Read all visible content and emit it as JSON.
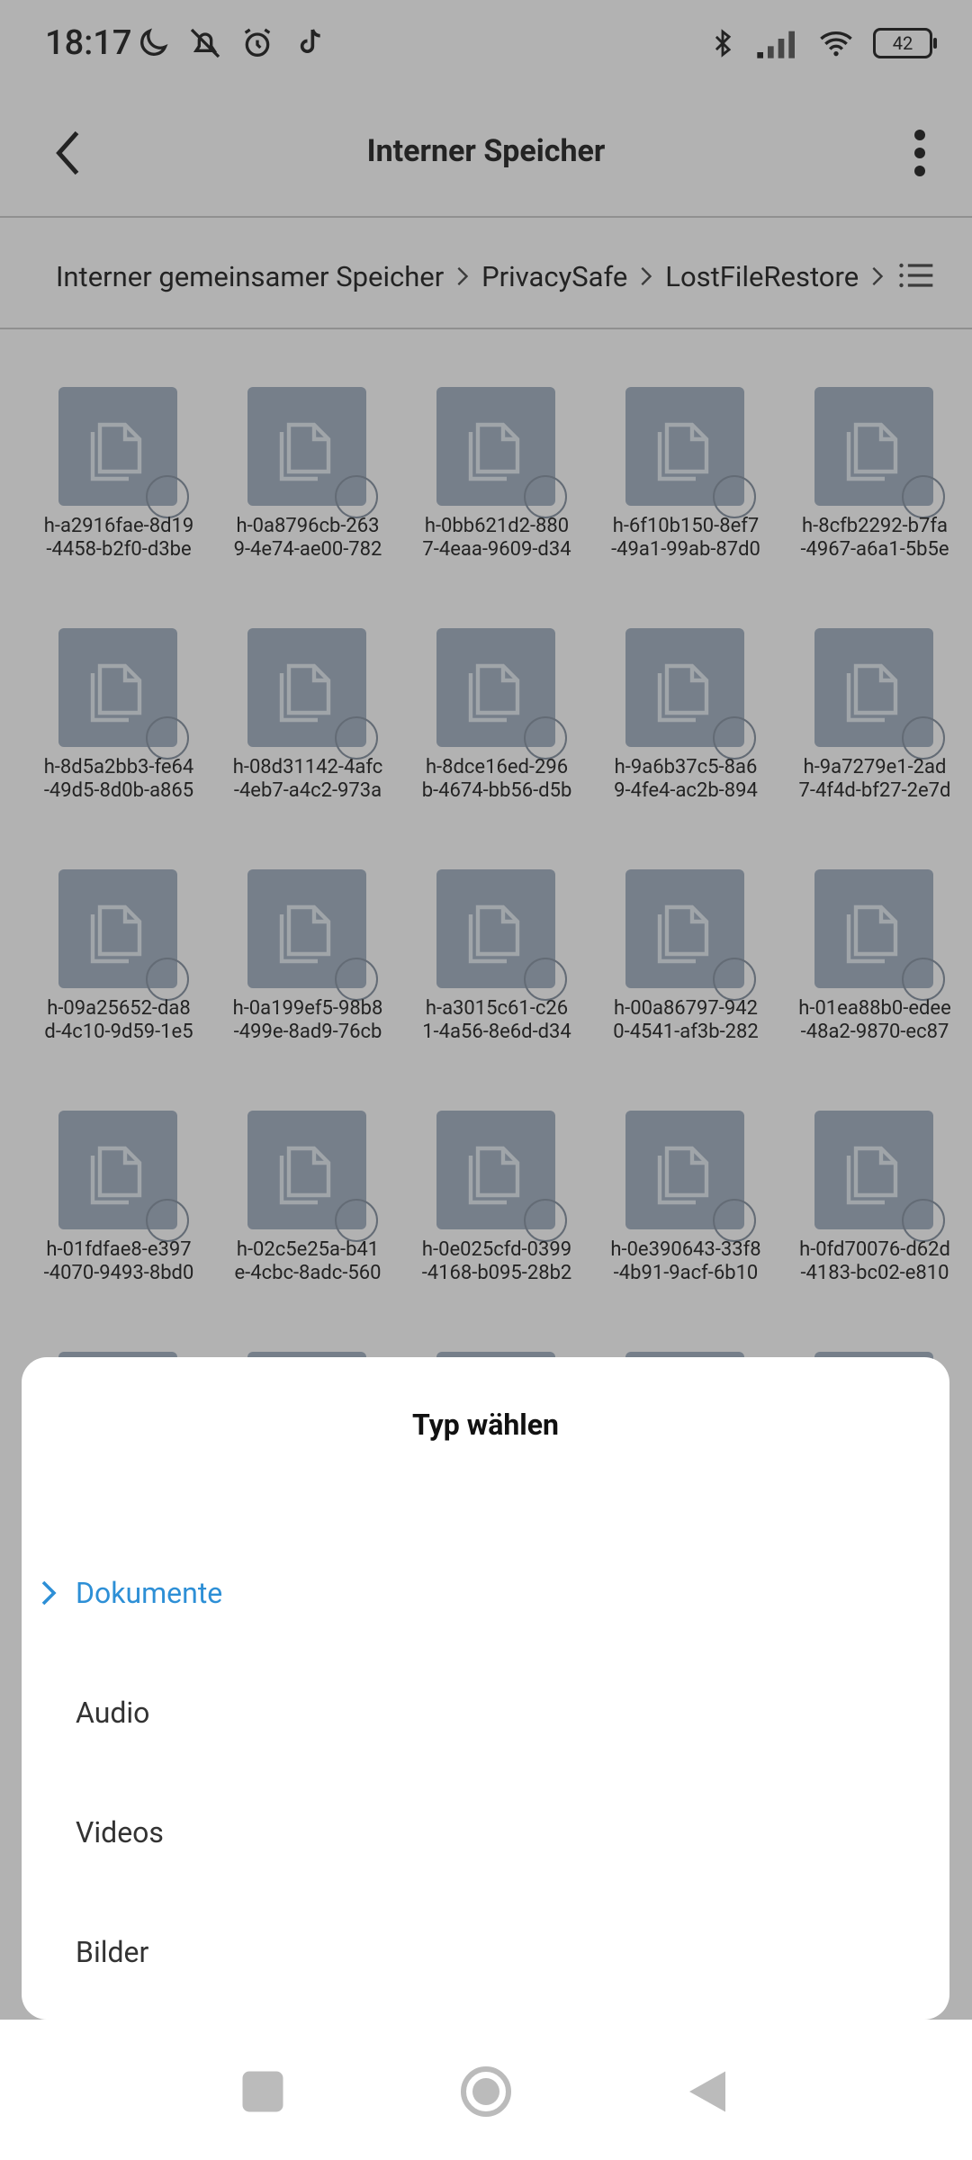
{
  "status": {
    "time": "18:17",
    "battery": "42",
    "icons_left": [
      "moon-icon",
      "bell-off-icon",
      "alarm-icon",
      "tiktok-icon"
    ],
    "icons_right": [
      "bluetooth-icon",
      "signal-icon",
      "wifi-icon",
      "battery-icon"
    ]
  },
  "appbar": {
    "title": "Interner Speicher"
  },
  "breadcrumb": [
    "Interner gemeinsamer Speicher",
    "PrivacySafe",
    "LostFileRestore"
  ],
  "files": [
    [
      "h-a2916fae-8d19",
      "-4458-b2f0-d3be"
    ],
    [
      "h-0a8796cb-263",
      "9-4e74-ae00-782"
    ],
    [
      "h-0bb621d2-880",
      "7-4eaa-9609-d34"
    ],
    [
      "h-6f10b150-8ef7",
      "-49a1-99ab-87d0"
    ],
    [
      "h-8cfb2292-b7fa",
      "-4967-a6a1-5b5e"
    ],
    [
      "h-8d5a2bb3-fe64",
      "-49d5-8d0b-a865"
    ],
    [
      "h-08d31142-4afc",
      "-4eb7-a4c2-973a"
    ],
    [
      "h-8dce16ed-296",
      "b-4674-bb56-d5b"
    ],
    [
      "h-9a6b37c5-8a6",
      "9-4fe4-ac2b-894"
    ],
    [
      "h-9a7279e1-2ad",
      "7-4f4d-bf27-2e7d"
    ],
    [
      "h-09a25652-da8",
      "d-4c10-9d59-1e5"
    ],
    [
      "h-0a199ef5-98b8",
      "-499e-8ad9-76cb"
    ],
    [
      "h-a3015c61-c26",
      "1-4a56-8e6d-d34"
    ],
    [
      "h-00a86797-942",
      "0-4541-af3b-282"
    ],
    [
      "h-01ea88b0-edee",
      "-48a2-9870-ec87"
    ],
    [
      "h-01fdfae8-e397",
      "-4070-9493-8bd0"
    ],
    [
      "h-02c5e25a-b41",
      "e-4cbc-8adc-560"
    ],
    [
      "h-0e025cfd-0399",
      "-4168-b095-28b2"
    ],
    [
      "h-0e390643-33f8",
      "-4b91-9acf-6b10"
    ],
    [
      "h-0fd70076-d62d",
      "-4183-bc02-e810"
    ]
  ],
  "sheet": {
    "title": "Typ wählen",
    "options": [
      {
        "label": "Dokumente",
        "selected": true
      },
      {
        "label": "Audio",
        "selected": false
      },
      {
        "label": "Videos",
        "selected": false
      },
      {
        "label": "Bilder",
        "selected": false
      }
    ]
  },
  "colors": {
    "accent": "#2d8fd6",
    "thumb": "#a9b6c6",
    "overlay": "rgba(0,0,0,0.30)"
  }
}
